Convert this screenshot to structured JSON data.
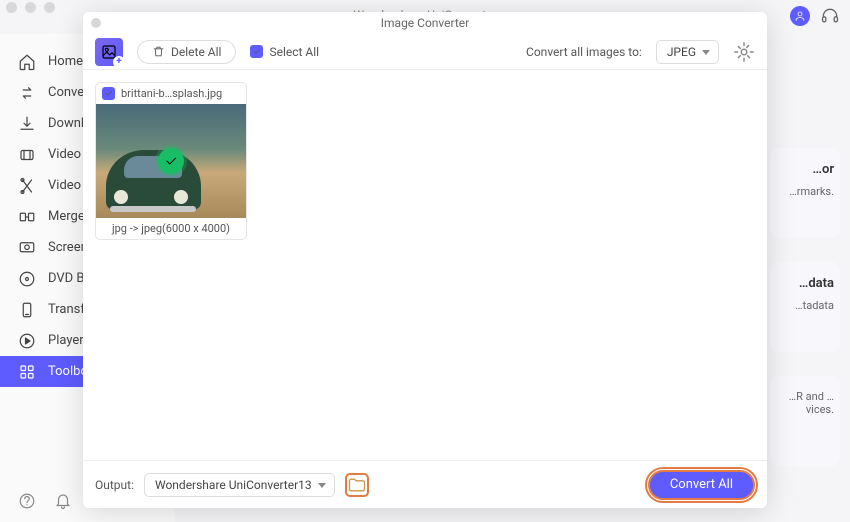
{
  "app_title": "Wondershare UniConverter",
  "sidebar": {
    "items": [
      {
        "label": "Home",
        "icon": "home"
      },
      {
        "label": "Converter",
        "icon": "convert"
      },
      {
        "label": "Downloader",
        "icon": "download"
      },
      {
        "label": "Video Compressor",
        "icon": "compress"
      },
      {
        "label": "Video Editor",
        "icon": "editor"
      },
      {
        "label": "Merger",
        "icon": "merger"
      },
      {
        "label": "Screen Recorder",
        "icon": "recorder"
      },
      {
        "label": "DVD Burner",
        "icon": "dvd"
      },
      {
        "label": "Transfer",
        "icon": "transfer"
      },
      {
        "label": "Player",
        "icon": "player"
      },
      {
        "label": "Toolbox",
        "icon": "toolbox"
      }
    ]
  },
  "right_cards": [
    {
      "title": "…or",
      "line": "…rmarks."
    },
    {
      "title": "…data",
      "line": "…tadata"
    },
    {
      "title": "",
      "line": "…R and …vices."
    }
  ],
  "modal": {
    "title": "Image Converter",
    "delete_all": "Delete All",
    "select_all": "Select All",
    "convert_to_label": "Convert all images to:",
    "format": "JPEG",
    "file": {
      "name": "brittani-b…splash.jpg",
      "status": "jpg -> jpeg(6000 x 4000)"
    },
    "output_label": "Output:",
    "output_path": "Wondershare UniConverter13",
    "convert_all": "Convert All"
  }
}
